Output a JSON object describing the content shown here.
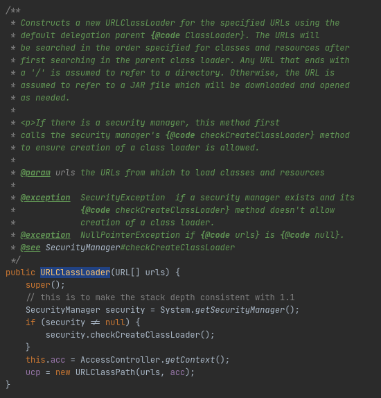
{
  "javadoc": {
    "l1": "/**",
    "l2a": " * ",
    "l2b": "Constructs a new URLClassLoader for the specified URLs using the",
    "l3a": " * ",
    "l3b": "default delegation parent ",
    "l3c": "{@code",
    "l3d": " ClassLoader}",
    "l3e": ". The URLs will",
    "l4a": " * ",
    "l4b": "be searched in the order specified for classes and resources after",
    "l5a": " * ",
    "l5b": "first searching in the parent class loader. Any URL that ends with",
    "l6a": " * ",
    "l6b": "a '/' is assumed to refer to a directory. Otherwise, the URL is",
    "l7a": " * ",
    "l7b": "assumed to refer to a JAR file which will be downloaded and opened",
    "l8a": " * ",
    "l8b": "as needed.",
    "l9": " *",
    "l10a": " * ",
    "l10b": "<p>",
    "l10c": "If there is a security manager, this method first",
    "l11a": " * ",
    "l11b": "calls the security manager's ",
    "l11c": "{@code",
    "l11d": " checkCreateClassLoader}",
    "l11e": " method",
    "l12a": " * ",
    "l12b": "to ensure creation of a class loader is allowed.",
    "l13": " *",
    "l14a": " * ",
    "l14b": "@param",
    "l14c": " ",
    "l14d": "urls",
    "l14e": " the URLs from which to load classes and resources",
    "l15": " *",
    "l16a": " * ",
    "l16b": "@exception",
    "l16c": "  SecurityException  if a security manager exists and its",
    "l17a": " *             ",
    "l17b": "{@code",
    "l17c": " checkCreateClassLoader}",
    "l17d": " method doesn't allow",
    "l18a": " *             ",
    "l18b": "creation of a class loader.",
    "l19a": " * ",
    "l19b": "@exception",
    "l19c": "  NullPointerException",
    "l19d": " if ",
    "l19e": "{@code",
    "l19f": " urls}",
    "l19g": " is ",
    "l19h": "{@code",
    "l19i": " null}",
    "l19j": ".",
    "l20a": " * ",
    "l20b": "@see",
    "l20c": " ",
    "l20d": "SecurityManager",
    "l20e": "#checkCreateClassLoader",
    "l21": " */"
  },
  "code": {
    "l22_public": "public",
    "l22_sp1": " ",
    "l22_name": "URLClassLoader",
    "l22_sig": "(URL[] urls) {",
    "l23_indent": "    ",
    "l23_super": "super",
    "l23_rest": "();",
    "l24_indent": "    ",
    "l24_cmt": "// this is to make the stack depth consistent with 1.1",
    "l25_indent": "    ",
    "l25_a": "SecurityManager security = System.",
    "l25_b": "getSecurityManager",
    "l25_c": "();",
    "l26_indent": "    ",
    "l26_if": "if",
    "l26_a": " (security != ",
    "l26_null": "null",
    "l26_b": ") {",
    "l27_indent": "        ",
    "l27_a": "security.checkCreateClassLoader();",
    "l28_indent": "    ",
    "l28_a": "}",
    "l29_indent": "    ",
    "l29_this": "this",
    "l29_a": ".",
    "l29_acc": "acc",
    "l29_b": " = AccessController.",
    "l29_c": "getContext",
    "l29_d": "();",
    "l30_indent": "    ",
    "l30_ucp": "ucp",
    "l30_a": " = ",
    "l30_new": "new",
    "l30_b": " URLClassPath(urls, ",
    "l30_acc": "acc",
    "l30_c": ");",
    "l31": "}"
  }
}
